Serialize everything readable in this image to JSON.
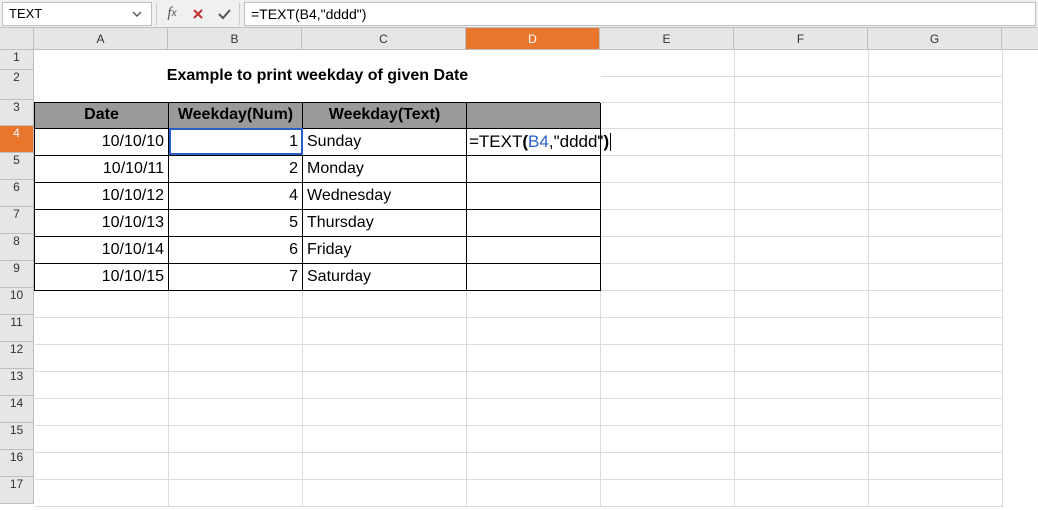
{
  "formula_bar": {
    "name_box": "TEXT",
    "formula": "=TEXT(B4,\"dddd\")"
  },
  "columns": [
    "A",
    "B",
    "C",
    "D",
    "E",
    "F",
    "G"
  ],
  "rows": [
    "1",
    "2",
    "3",
    "4",
    "5",
    "6",
    "7",
    "8",
    "9",
    "10",
    "11",
    "12",
    "13",
    "14",
    "15",
    "16",
    "17"
  ],
  "active_col": "D",
  "active_row": "4",
  "title": "Example to print weekday of given Date",
  "headers": {
    "date": "Date",
    "wnum": "Weekday(Num)",
    "wtext": "Weekday(Text)"
  },
  "data_rows": [
    {
      "date": "10/10/10",
      "num": "1",
      "text": "Sunday"
    },
    {
      "date": "10/10/11",
      "num": "2",
      "text": "Monday"
    },
    {
      "date": "10/10/12",
      "num": "4",
      "text": "Wednesday"
    },
    {
      "date": "10/10/13",
      "num": "5",
      "text": "Thursday"
    },
    {
      "date": "10/10/14",
      "num": "6",
      "text": "Friday"
    },
    {
      "date": "10/10/15",
      "num": "7",
      "text": "Saturday"
    }
  ],
  "editing": {
    "fn": "=TEXT",
    "open": "(",
    "ref": "B4",
    "comma": ",",
    "str": "\"dddd\"",
    "close": ")"
  }
}
